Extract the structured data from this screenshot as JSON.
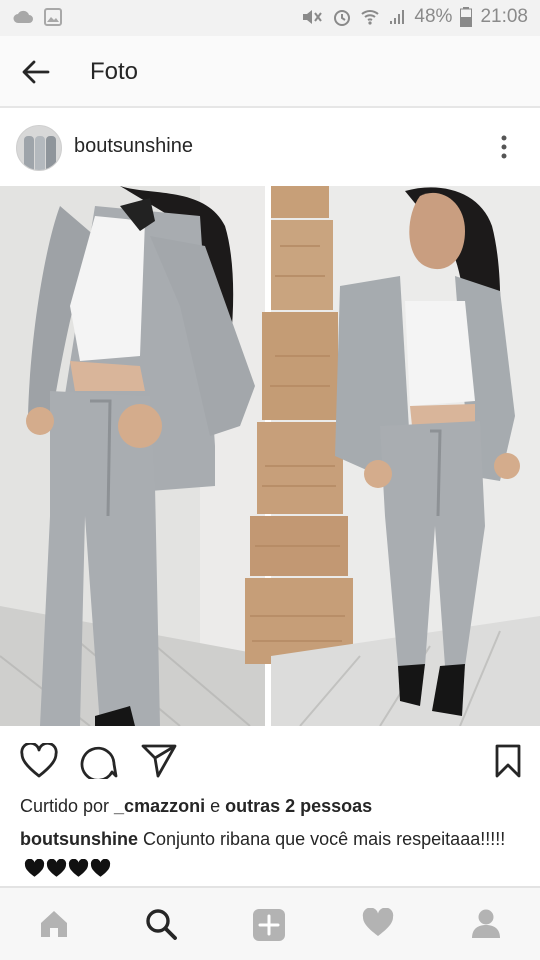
{
  "status_bar": {
    "battery": "48%",
    "time": "21:08",
    "icons": [
      "cloud-icon",
      "image-icon",
      "mute-icon",
      "alarm-icon",
      "wifi-icon",
      "signal-icon",
      "battery-icon"
    ]
  },
  "app_bar": {
    "title": "Foto",
    "back_icon": "arrow-left-icon"
  },
  "post": {
    "username": "boutsunshine",
    "more_icon": "more-vertical-icon",
    "actions": [
      "heart-icon",
      "comment-icon",
      "share-icon",
      "bookmark-icon"
    ],
    "likes": {
      "prefix": "Curtido por ",
      "user": "_cmazzoni",
      "middle": " e ",
      "others": "outras 2 pessoas"
    },
    "caption": {
      "username": "boutsunshine",
      "text": " Conjunto ribana que você mais respeitaaa!!!!!",
      "emoji_hearts": 4
    }
  },
  "bottom_nav": {
    "items": [
      "home-icon",
      "search-icon",
      "add-icon",
      "activity-heart-icon",
      "profile-icon"
    ],
    "active": "search-icon"
  },
  "colors": {
    "text": "#262626",
    "inactive_icon": "#b3b3b3",
    "status_gray": "#8a8a8a"
  }
}
